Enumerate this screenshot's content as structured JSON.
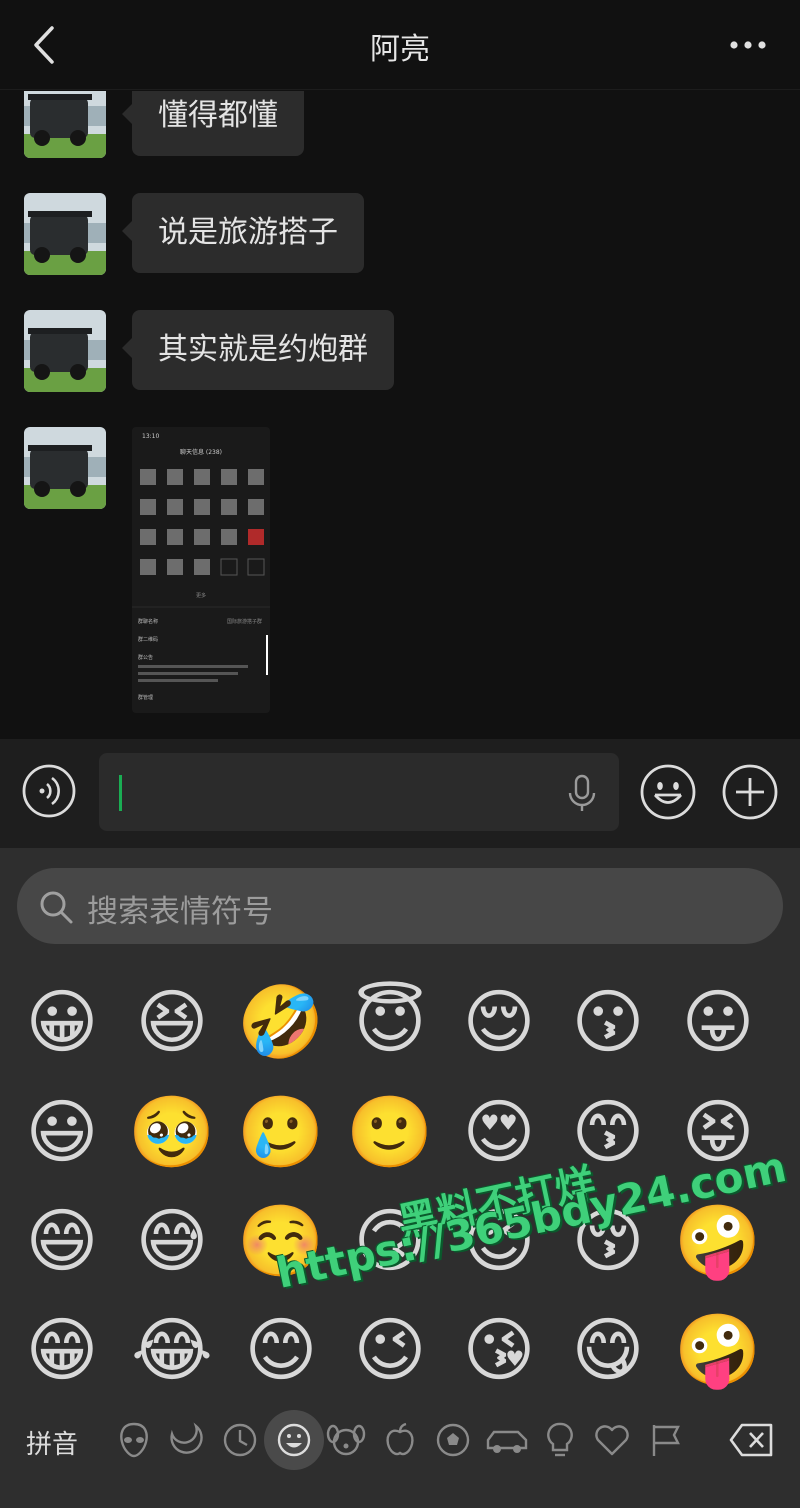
{
  "header": {
    "title": "阿亮",
    "back_icon": "chevron-left-icon",
    "more_icon": "more-dots-icon"
  },
  "messages": [
    {
      "type": "text",
      "text": "懂得都懂"
    },
    {
      "type": "text",
      "text": "说是旅游搭子"
    },
    {
      "type": "text",
      "text": "其实就是约炮群"
    },
    {
      "type": "image",
      "screenshot": {
        "time": "13:10",
        "title": "聊天信息 (238)",
        "row1": "群聊名称",
        "row1_value": "国际旅游搭子群",
        "row2": "群二维码",
        "row3": "群公告",
        "row4": "群管理",
        "more": "更多"
      }
    }
  ],
  "input_bar": {
    "voice_icon": "voice-icon",
    "mic_icon": "mic-icon",
    "emoji_icon": "emoji-face-icon",
    "plus_icon": "plus-circle-icon"
  },
  "emoji_panel": {
    "search_placeholder": "搜索表情符号",
    "emojis": [
      [
        "😀",
        "😆",
        "🤣",
        "😇",
        "😌",
        "😗",
        "😛"
      ],
      [
        "😃",
        "🥹",
        "🥲",
        "🙂",
        "😍",
        "😙",
        "😝"
      ],
      [
        "😄",
        "😅",
        "☺️",
        "🙃",
        "😉",
        "😚",
        "🤪"
      ],
      [
        "😁",
        "😂",
        "😊",
        "😉",
        "😘",
        "😋",
        "🤪"
      ]
    ],
    "toolbar": {
      "pinyin_label": "拼音",
      "delete_icon": "backspace-icon"
    }
  },
  "watermark": {
    "line1": "黑料不打烊",
    "line2": "https://365bdy24.com"
  },
  "colors": {
    "background": "#111111",
    "bubble": "#2c2c2c",
    "panel": "#2e2e2e",
    "accent": "#1aad53"
  }
}
